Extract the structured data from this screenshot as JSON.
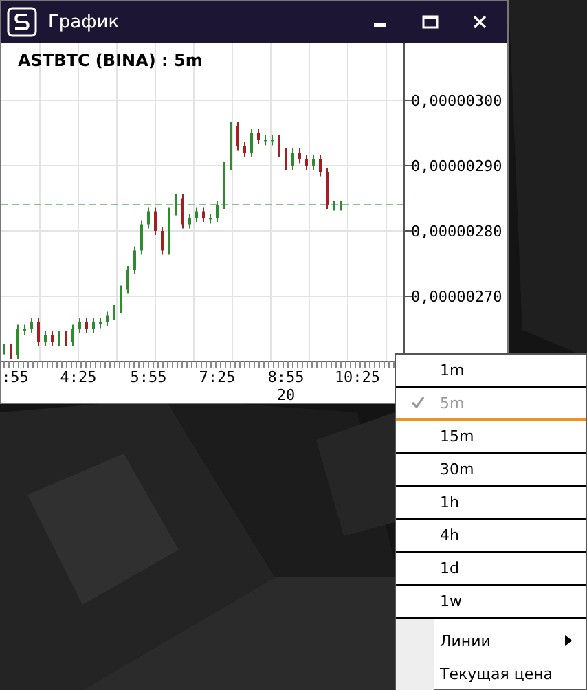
{
  "window": {
    "title": "График"
  },
  "chart": {
    "title": "ASTBTC (BINA) : 5m",
    "y_labels": [
      "0,00000300",
      "0,00000290",
      "0,00000280",
      "0,00000270"
    ],
    "x_labels": [
      ":55",
      "4:25",
      "5:55",
      "7:25",
      "8:55",
      "10:25"
    ],
    "date_label": "20"
  },
  "menu": {
    "items": [
      {
        "kind": "timeframe",
        "label": "1m",
        "selected": false
      },
      {
        "kind": "timeframe",
        "label": "5m",
        "selected": true
      },
      {
        "kind": "timeframe",
        "label": "15m",
        "selected": false
      },
      {
        "kind": "timeframe",
        "label": "30m",
        "selected": false
      },
      {
        "kind": "timeframe",
        "label": "1h",
        "selected": false
      },
      {
        "kind": "timeframe",
        "label": "4h",
        "selected": false
      },
      {
        "kind": "timeframe",
        "label": "1d",
        "selected": false
      },
      {
        "kind": "timeframe",
        "label": "1w",
        "selected": false
      },
      {
        "kind": "submenu",
        "label": "Линии"
      },
      {
        "kind": "action",
        "label": "Текущая цена"
      }
    ]
  }
}
